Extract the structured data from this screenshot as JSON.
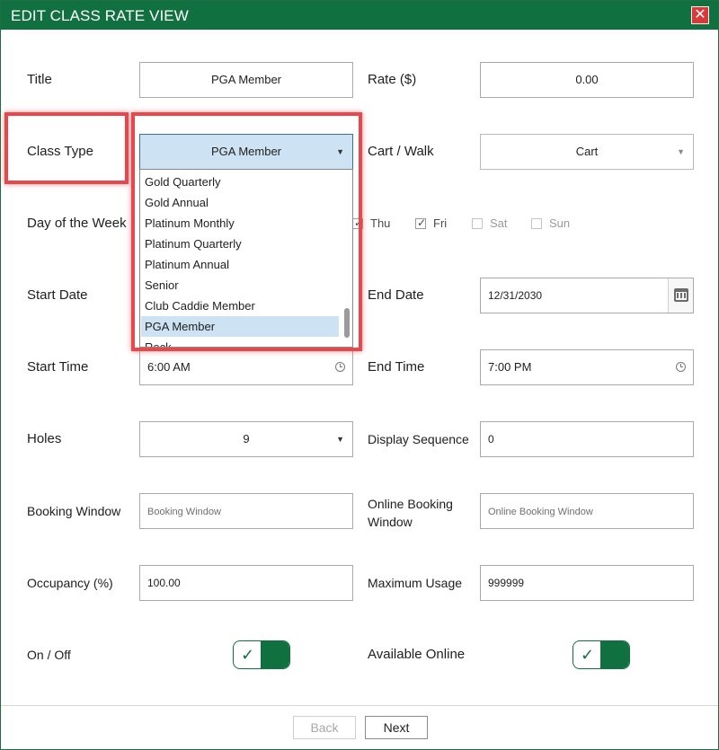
{
  "window": {
    "title": "EDIT CLASS RATE VIEW",
    "close_label": "✕"
  },
  "fields": {
    "title": {
      "label": "Title",
      "value": "PGA Member"
    },
    "rate": {
      "label": "Rate ($)",
      "value": "0.00"
    },
    "class_type": {
      "label": "Class Type",
      "value": "PGA Member"
    },
    "cart_walk": {
      "label": "Cart / Walk",
      "value": "Cart"
    },
    "day_of_week": {
      "label": "Day of the Week",
      "days": [
        {
          "label": "Thu",
          "checked": true
        },
        {
          "label": "Fri",
          "checked": true
        },
        {
          "label": "Sat",
          "checked": false
        },
        {
          "label": "Sun",
          "checked": false
        }
      ]
    },
    "start_date": {
      "label": "Start Date"
    },
    "end_date": {
      "label": "End Date",
      "value": "12/31/2030"
    },
    "start_time": {
      "label": "Start Time",
      "value": "6:00 AM"
    },
    "end_time": {
      "label": "End Time",
      "value": "7:00 PM"
    },
    "holes": {
      "label": "Holes",
      "value": "9"
    },
    "display_sequence": {
      "label": "Display Sequence",
      "value": "0"
    },
    "booking_window": {
      "label": "Booking Window",
      "placeholder": "Booking Window"
    },
    "online_booking_window": {
      "label_line1": "Online Booking",
      "label_line2": "Window",
      "placeholder": "Online Booking Window"
    },
    "occupancy": {
      "label": "Occupancy (%)",
      "value": "100.00"
    },
    "maximum_usage": {
      "label": "Maximum Usage",
      "value": "999999"
    },
    "on_off": {
      "label": "On / Off",
      "on": true
    },
    "available_online": {
      "label": "Available Online",
      "on": true
    }
  },
  "class_type_dropdown": {
    "options": [
      "Gold Quarterly",
      "Gold Annual",
      "Platinum Monthly",
      "Platinum Quarterly",
      "Platinum Annual",
      "Senior",
      "Club Caddie Member",
      "PGA Member",
      "Reck"
    ],
    "selected": "PGA Member"
  },
  "footer": {
    "back_label": "Back",
    "next_label": "Next"
  },
  "colors": {
    "brand_green": "#107040",
    "highlight_red": "#e8474b",
    "selection_blue": "#cde2f2",
    "close_red": "#d63a3a"
  }
}
